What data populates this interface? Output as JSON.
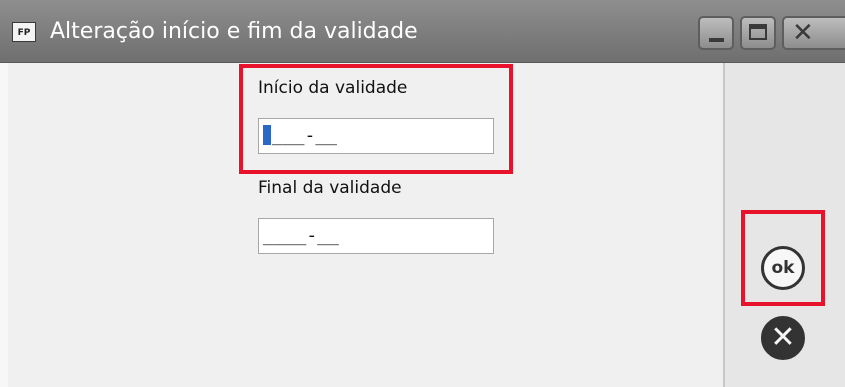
{
  "window": {
    "title": "Alteração início e fim da validade",
    "app_icon_text": "FP",
    "controls": {
      "minimize_icon": "minimize-icon",
      "maximize_icon": "maximize-icon",
      "close_icon": "close-icon"
    }
  },
  "form": {
    "inicio": {
      "label": "Início da validade",
      "value": "___-__"
    },
    "final": {
      "label": "Final da validade",
      "value": "____-__"
    }
  },
  "actions": {
    "ok_label": "ok",
    "cancel_icon": "cancel-x-icon"
  },
  "colors": {
    "highlight": "#e8132b",
    "titlebar": "#7f7f7f",
    "caret": "#2a68c8"
  }
}
